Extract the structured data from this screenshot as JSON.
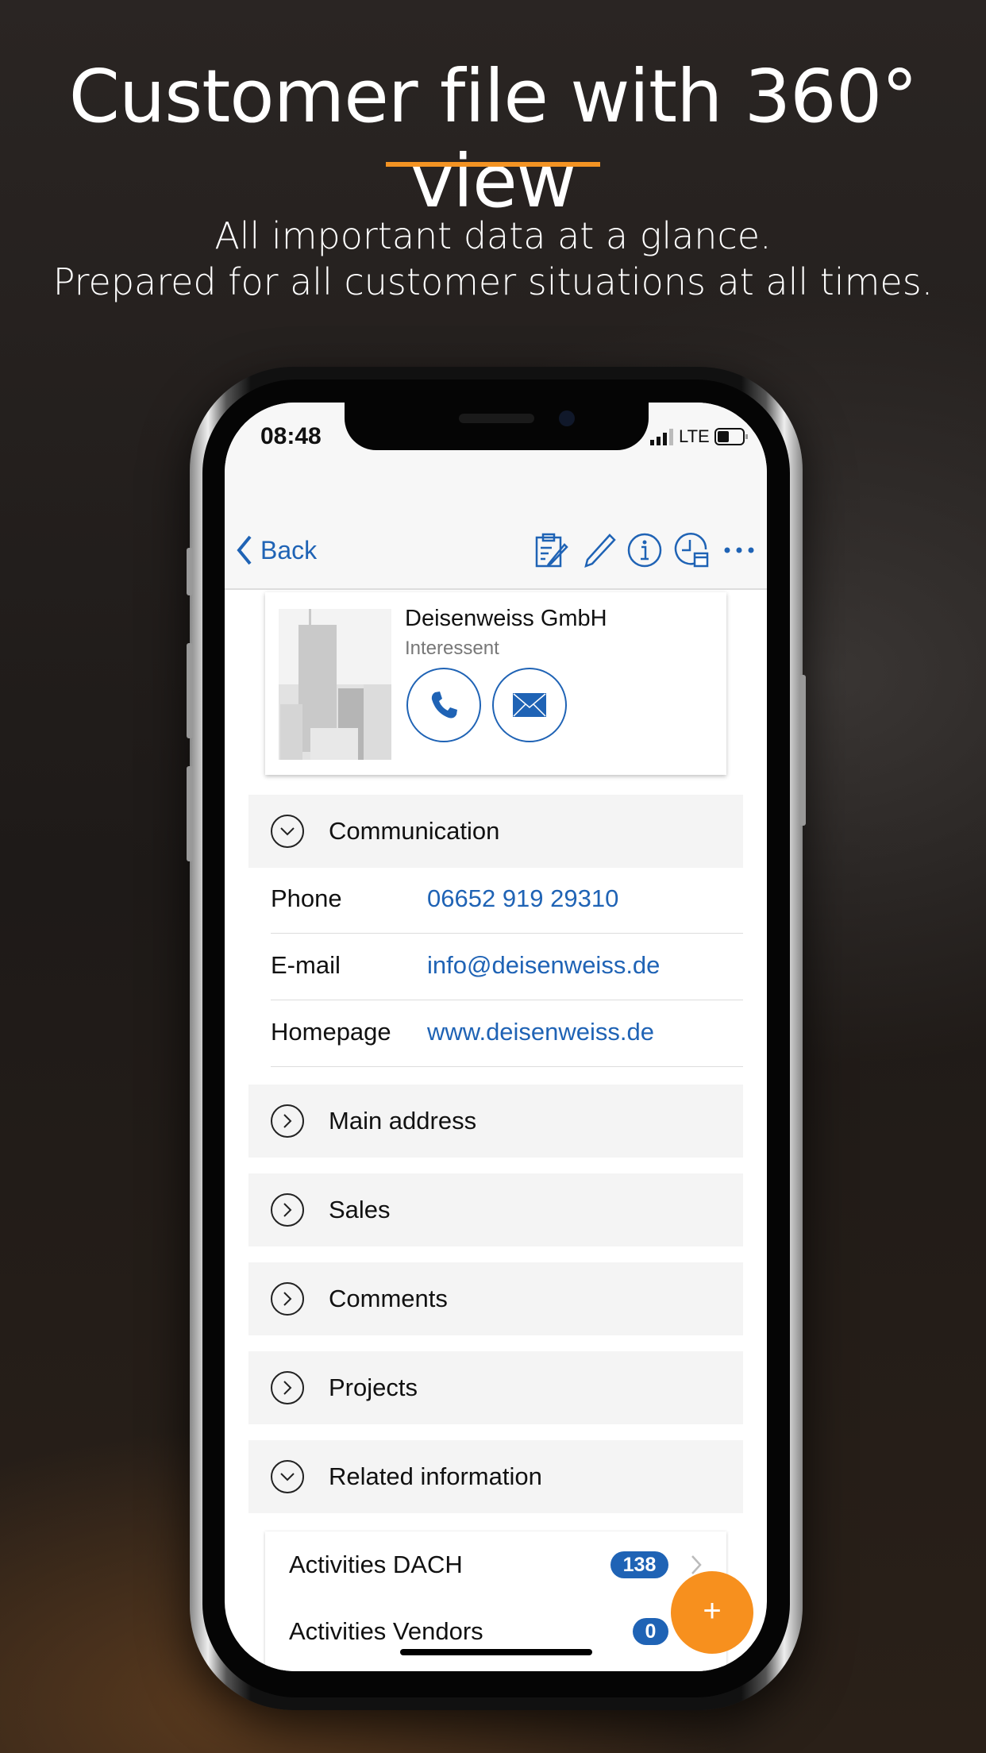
{
  "headline": {
    "title": "Customer file with 360° view",
    "subtitle_line1": "All important data at a glance.",
    "subtitle_line2": "Prepared for all customer situations at all times.",
    "accent": "#f39323"
  },
  "status_bar": {
    "time": "08:48",
    "network": "LTE"
  },
  "nav": {
    "back_label": "Back",
    "icons": [
      "clipboard-edit-icon",
      "pencil-icon",
      "info-icon",
      "clock-calendar-icon",
      "more-icon"
    ]
  },
  "company": {
    "name": "Deisenweiss GmbH",
    "status": "Interessent"
  },
  "communication": {
    "title": "Communication",
    "rows": [
      {
        "label": "Phone",
        "value": "06652 919 29310"
      },
      {
        "label": "E-mail",
        "value": "info@deisenweiss.de"
      },
      {
        "label": "Homepage",
        "value": "www.deisenweiss.de"
      }
    ]
  },
  "sections": [
    "Main address",
    "Sales",
    "Comments",
    "Projects"
  ],
  "related": {
    "title": "Related information",
    "items": [
      {
        "label": "Activities DACH",
        "count": "138"
      },
      {
        "label": "Activities Vendors",
        "count": "0"
      }
    ]
  },
  "fab": {
    "label": "+",
    "color": "#f7901e"
  },
  "colors": {
    "link": "#1f63b5"
  }
}
